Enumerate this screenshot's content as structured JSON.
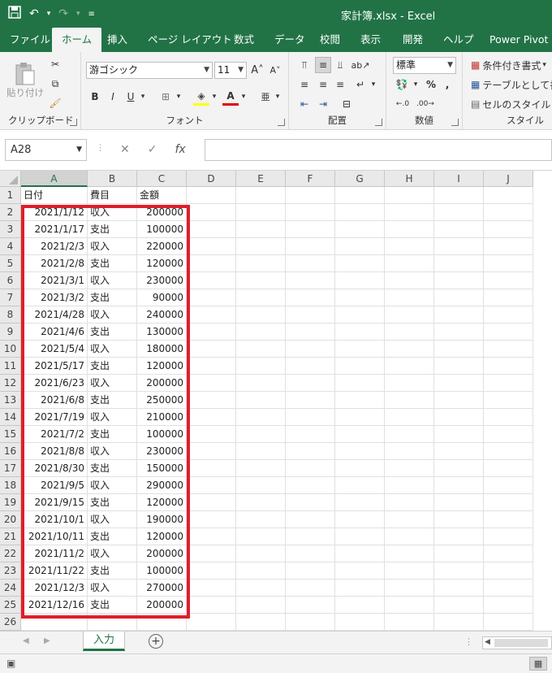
{
  "window": {
    "title": "家計簿.xlsx  -  Excel"
  },
  "ribbon_tabs": [
    "ファイル",
    "ホーム",
    "挿入",
    "ページ レイアウト",
    "数式",
    "データ",
    "校閲",
    "表示",
    "開発",
    "ヘルプ",
    "Power Pivot"
  ],
  "ribbon": {
    "clipboard": {
      "label": "クリップボード",
      "paste_label": "貼り付け"
    },
    "font": {
      "label": "フォント",
      "font_name": "游ゴシック",
      "font_size": "11"
    },
    "alignment": {
      "label": "配置"
    },
    "number": {
      "label": "数値",
      "format": "標準"
    },
    "styles": {
      "label": "スタイル",
      "conditional": "条件付き書式",
      "table": "テーブルとして書式",
      "cell": "セルのスタイル"
    }
  },
  "formula_bar": {
    "name_box": "A28",
    "formula": ""
  },
  "columns": [
    "A",
    "B",
    "C",
    "D",
    "E",
    "F",
    "G",
    "H",
    "I",
    "J"
  ],
  "rows": [
    [
      "日付",
      "費目",
      "金額"
    ],
    [
      "2021/1/12",
      "収入",
      "200000"
    ],
    [
      "2021/1/17",
      "支出",
      "100000"
    ],
    [
      "2021/2/3",
      "収入",
      "220000"
    ],
    [
      "2021/2/8",
      "支出",
      "120000"
    ],
    [
      "2021/3/1",
      "収入",
      "230000"
    ],
    [
      "2021/3/2",
      "支出",
      "90000"
    ],
    [
      "2021/4/28",
      "収入",
      "240000"
    ],
    [
      "2021/4/6",
      "支出",
      "130000"
    ],
    [
      "2021/5/4",
      "収入",
      "180000"
    ],
    [
      "2021/5/17",
      "支出",
      "120000"
    ],
    [
      "2021/6/23",
      "収入",
      "200000"
    ],
    [
      "2021/6/8",
      "支出",
      "250000"
    ],
    [
      "2021/7/19",
      "収入",
      "210000"
    ],
    [
      "2021/7/2",
      "支出",
      "100000"
    ],
    [
      "2021/8/8",
      "収入",
      "230000"
    ],
    [
      "2021/8/30",
      "支出",
      "150000"
    ],
    [
      "2021/9/5",
      "収入",
      "290000"
    ],
    [
      "2021/9/15",
      "支出",
      "120000"
    ],
    [
      "2021/10/1",
      "収入",
      "190000"
    ],
    [
      "2021/10/11",
      "支出",
      "120000"
    ],
    [
      "2021/11/2",
      "収入",
      "200000"
    ],
    [
      "2021/11/22",
      "支出",
      "100000"
    ],
    [
      "2021/12/3",
      "収入",
      "270000"
    ],
    [
      "2021/12/16",
      "支出",
      "200000"
    ],
    [
      "",
      "",
      ""
    ]
  ],
  "sheet_tabs": [
    "入力"
  ],
  "colors": {
    "excel_green": "#217346",
    "highlight_red": "#e01e2a"
  }
}
